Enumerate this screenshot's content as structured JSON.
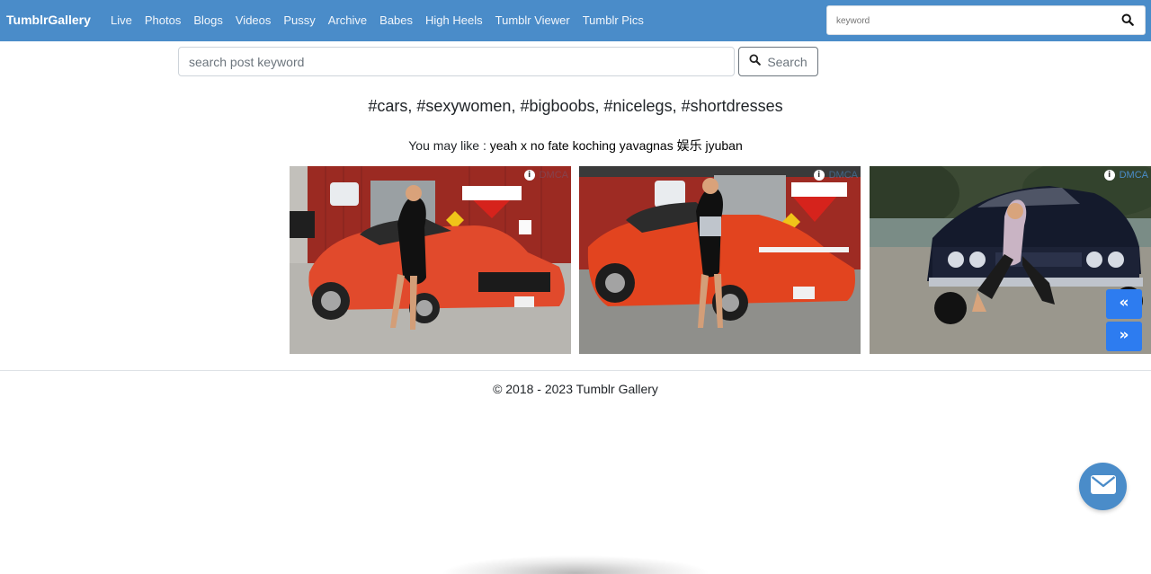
{
  "navbar": {
    "brand": "TumblrGallery",
    "links": [
      "Live",
      "Photos",
      "Blogs",
      "Videos",
      "Pussy",
      "Archive",
      "Babes",
      "High Heels",
      "Tumblr Viewer",
      "Tumblr Pics"
    ],
    "search_placeholder": "keyword",
    "search_icon": "search-icon",
    "bg_color": "#4a8cc9"
  },
  "post_search": {
    "placeholder": "search post keyword",
    "button_label": "Search",
    "button_icon": "search-icon"
  },
  "tags": "#cars, #sexywomen, #bigboobs, #nicelegs, #shortdresses",
  "you_may_like": {
    "prefix": "You may like :",
    "items": [
      "yeah x",
      "no fate",
      "koching",
      "yavagnas",
      "娱乐",
      "jyuban"
    ]
  },
  "gallery": {
    "dmca_label": "DMCA",
    "dmca_icon": "info-icon",
    "prev_icon": "double-chevron-left-icon",
    "next_icon": "double-chevron-right-icon",
    "prev_glyph": "«",
    "next_glyph": "»"
  },
  "footer": {
    "copyright": "© 2018 - 2023 Tumblr Gallery"
  },
  "contact": {
    "icon": "envelope-icon"
  }
}
